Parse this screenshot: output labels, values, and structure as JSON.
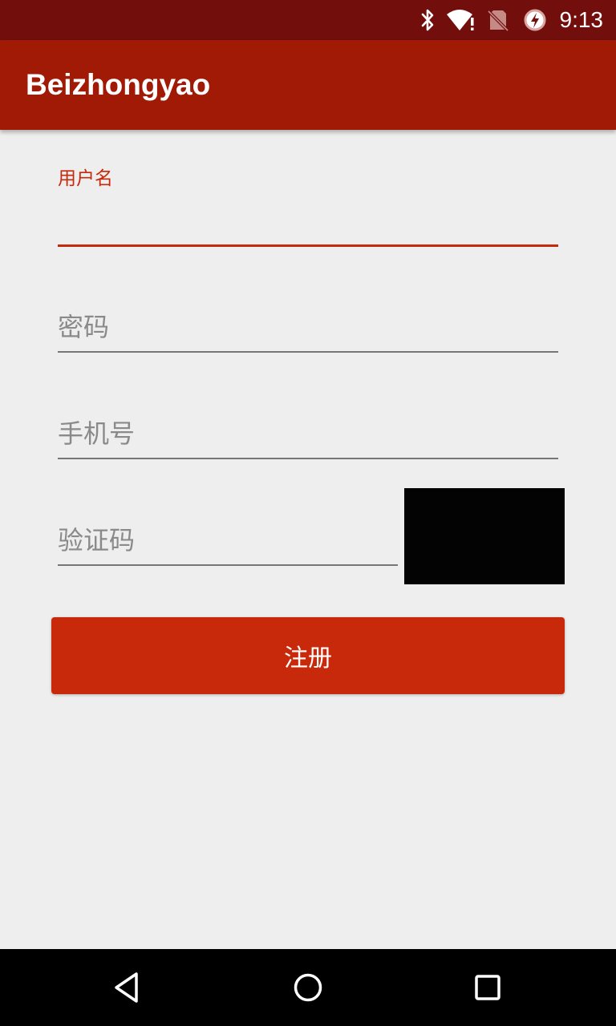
{
  "status_bar": {
    "time": "9:13",
    "icons": [
      "bluetooth-icon",
      "wifi-alert-icon",
      "no-sim-icon",
      "battery-saver-icon"
    ]
  },
  "app_bar": {
    "title": "Beizhongyao"
  },
  "form": {
    "username": {
      "label": "用户名",
      "value": ""
    },
    "password": {
      "placeholder": "密码",
      "value": ""
    },
    "phone": {
      "placeholder": "手机号",
      "value": ""
    },
    "captcha": {
      "placeholder": "验证码",
      "value": ""
    },
    "register_label": "注册"
  },
  "nav_bar": {
    "icons": [
      "back-icon",
      "home-icon",
      "recents-icon"
    ]
  },
  "colors": {
    "status_bar": "#720f0d",
    "app_bar": "#a01a05",
    "accent": "#c42a0c",
    "button": "#c9290b",
    "background": "#eeeeee"
  }
}
